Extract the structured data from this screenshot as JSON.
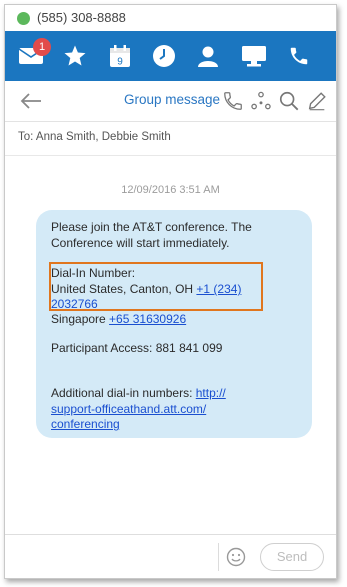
{
  "status": {
    "phone_number": "(585) 308-8888",
    "presence_color": "#5cb85c"
  },
  "nav": {
    "items": [
      {
        "icon": "envelope-icon",
        "badge": "1"
      },
      {
        "icon": "star-icon"
      },
      {
        "icon": "calendar-icon",
        "day": "9"
      },
      {
        "icon": "clock-icon"
      },
      {
        "icon": "contact-icon"
      },
      {
        "icon": "monitor-icon"
      },
      {
        "icon": "phone-icon"
      }
    ],
    "bg_color": "#1b76c0"
  },
  "header": {
    "title": "Group message"
  },
  "recipients": "To: Anna Smith, Debbie Smith",
  "message": {
    "timestamp": "12/09/2016 3:51 AM",
    "line1": "Please join the AT&T conference. The",
    "line2": "Conference will start immediately.",
    "dialin_label": "Dial-In Number:",
    "us_text": "United States, Canton, OH ",
    "us_link_a": "+1 (234)",
    "us_link_b": "2032766",
    "sg_text": "Singapore ",
    "sg_link": "+65 31630926",
    "participant_access": "Participant Access: 881 841 099",
    "additional_text": "Additional dial-in numbers: ",
    "additional_link_a": "http://",
    "additional_link_b": "support-officeathand.att.com/",
    "additional_link_c": "conferencing",
    "bubble_color": "#d4eaf7",
    "highlight_color": "#e0761e"
  },
  "composer": {
    "send_label": "Send"
  }
}
